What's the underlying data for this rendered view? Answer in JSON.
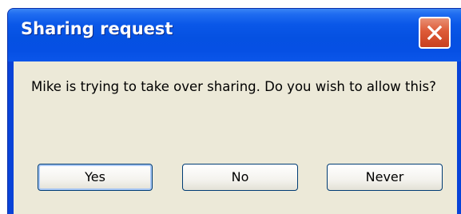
{
  "window": {
    "title": "Sharing request",
    "close_icon": "close-icon"
  },
  "message": "Mike is trying to take over sharing. Do you wish to allow this?",
  "buttons": {
    "yes": "Yes",
    "no": "No",
    "never": "Never"
  },
  "colors": {
    "titlebar": "#0551e2",
    "close_button": "#dd5a37",
    "client_background": "#ece9d8",
    "button_border": "#003c74"
  }
}
